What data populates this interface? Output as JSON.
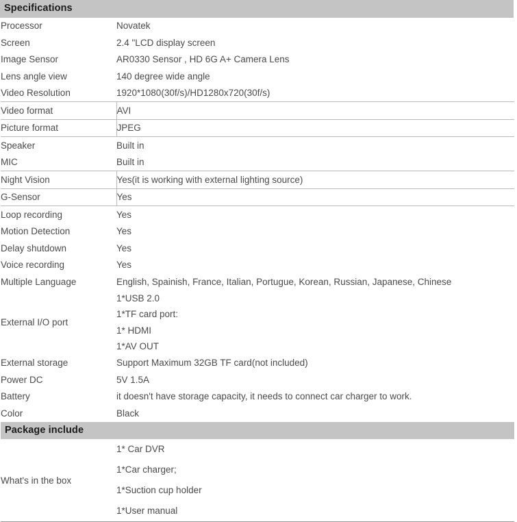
{
  "sections": [
    {
      "id": "specifications",
      "title": "Specifications",
      "rows": [
        {
          "key": "Processor",
          "value": "Novatek",
          "boxed": false
        },
        {
          "key": "Screen",
          "value": "2.4 \"LCD display screen",
          "boxed": false
        },
        {
          "key": "Image Sensor",
          "value": "AR0330 Sensor , HD 6G A+ Camera Lens",
          "boxed": false
        },
        {
          "key": "Lens angle view",
          "value": "140 degree wide angle",
          "boxed": false
        },
        {
          "key": "Video Resolution",
          "value": "1920*1080(30f/s)/HD1280x720(30f/s)",
          "boxed": false
        },
        {
          "key": "Video format",
          "value": "AVI",
          "boxed": true
        },
        {
          "key": "Picture format",
          "value": "JPEG",
          "boxed": true
        },
        {
          "key": "Speaker",
          "value": "Built in",
          "boxed": false
        },
        {
          "key": "MIC",
          "value": "Built in",
          "boxed": false
        },
        {
          "key": "Night Vision",
          "value": "Yes(it is working with external lighting source)",
          "boxed": true
        },
        {
          "key": "G-Sensor",
          "value": "Yes",
          "boxed": true
        },
        {
          "key": "Loop recording",
          "value": "Yes",
          "boxed": false
        },
        {
          "key": "Motion Detection",
          "value": "Yes",
          "boxed": false
        },
        {
          "key": "Delay shutdown",
          "value": "Yes",
          "boxed": false
        },
        {
          "key": "Voice recording",
          "value": "Yes",
          "boxed": false
        },
        {
          "key": "Multiple Language",
          "value": "English, Spainish, France, Italian, Portugue, Korean, Russian, Japanese, Chinese",
          "boxed": false
        },
        {
          "key": "External I/O port",
          "lines": [
            "1*USB 2.0",
            "1*TF card port:",
            "1* HDMI",
            "1*AV OUT"
          ],
          "boxed": false
        },
        {
          "key": "External storage",
          "value": "Support Maximum 32GB TF card(not included)",
          "boxed": false
        },
        {
          "key": "Power DC",
          "value": "5V 1.5A",
          "boxed": false
        },
        {
          "key": "Battery",
          "value": "it doesn't have storage capacity, it needs to connect car charger to work.",
          "boxed": false
        },
        {
          "key": "Color",
          "value": "Black",
          "boxed": false
        }
      ]
    },
    {
      "id": "package-include",
      "title": "Package include",
      "rows": [
        {
          "key": "What's in the box",
          "lines": [
            "1* Car DVR",
            "1*Car charger;",
            "1*Suction cup holder",
            "1*User manual"
          ],
          "boxed": false
        }
      ]
    }
  ],
  "style": {
    "banner_background": "#c4c4c4",
    "banner_text_color": "#1a1a1a",
    "body_text_color": "#4a4a4a",
    "grid_line_color": "#b9b9b9",
    "page_background": "#ffffff"
  }
}
